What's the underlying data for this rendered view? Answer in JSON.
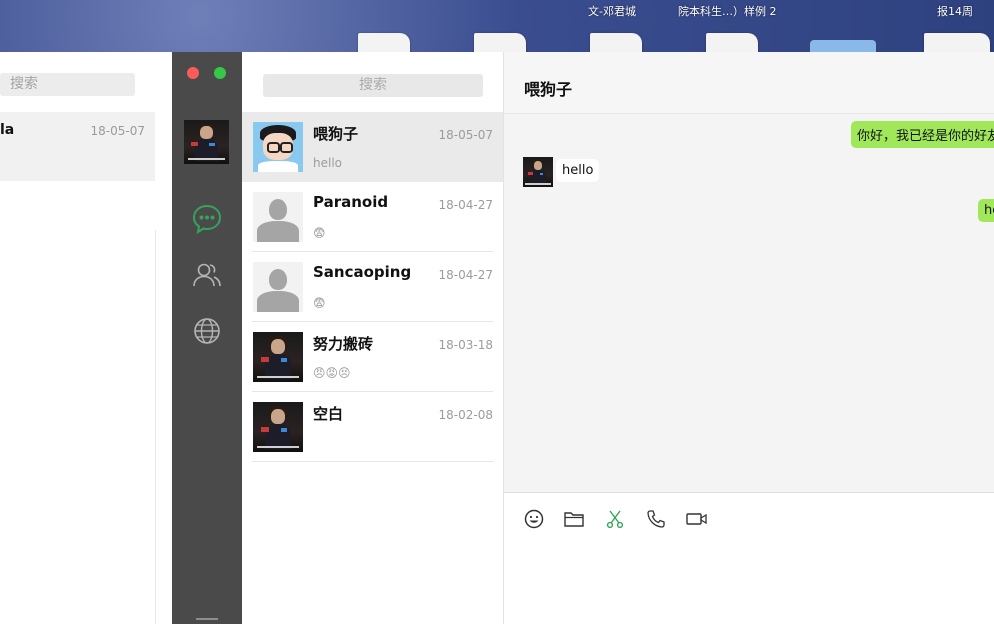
{
  "desktop": {
    "labels": [
      "文-邓君城",
      "院本科生…）样例 2",
      "报14周"
    ]
  },
  "bg_window": {
    "search_placeholder": "搜索",
    "row_name": "la",
    "row_date": "18-05-07"
  },
  "list": {
    "search_placeholder": "搜索",
    "conversations": [
      {
        "name": "喂狗子",
        "date": "18-05-07",
        "preview": "hello",
        "avatar": "cartoon-avatar"
      },
      {
        "name": "Paranoid",
        "date": "18-04-27",
        "preview": "😨",
        "avatar": "default-avatar"
      },
      {
        "name": "Sancaoping",
        "date": "18-04-27",
        "preview": "😨",
        "avatar": "default-avatar"
      },
      {
        "name": "努力搬砖",
        "date": "18-03-18",
        "preview": "😠😡😣",
        "avatar": "photo-avatar"
      },
      {
        "name": "空白",
        "date": "18-02-08",
        "preview": "",
        "avatar": "photo-avatar"
      }
    ]
  },
  "chat": {
    "title": "喂狗子",
    "messages": [
      {
        "direction": "out",
        "text": "你好，我已经是你的好友"
      },
      {
        "direction": "in",
        "text": "hello"
      },
      {
        "direction": "out",
        "text": "he"
      }
    ]
  },
  "toolbar": {
    "icons": [
      "emoji-icon",
      "folder-icon",
      "scissors-icon",
      "phone-icon",
      "video-icon"
    ]
  },
  "colors": {
    "sidebar": "#4a4a4a",
    "bubble_out": "#a0e75a",
    "accent_green": "#35a35a",
    "traffic_red": "#fc5c57",
    "traffic_green": "#35c747"
  }
}
